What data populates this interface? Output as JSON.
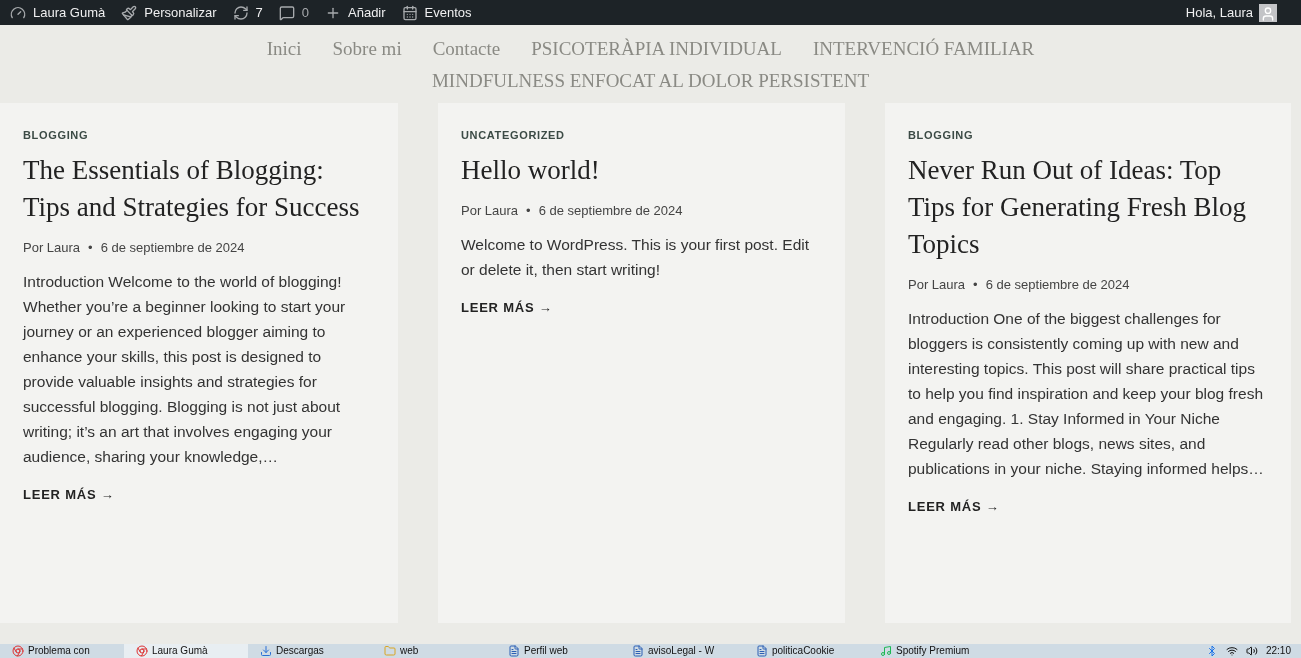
{
  "admin_bar": {
    "items": [
      {
        "kind": "dashboard",
        "label": "Laura Gumà"
      },
      {
        "kind": "customize",
        "label": "Personalizar"
      },
      {
        "kind": "updates",
        "label": "7"
      },
      {
        "kind": "comments",
        "label": "0"
      },
      {
        "kind": "add",
        "label": "Añadir"
      },
      {
        "kind": "events",
        "label": "Eventos"
      }
    ],
    "greeting": "Hola, Laura"
  },
  "nav": {
    "items": [
      "Inici",
      "Sobre mi",
      "Contacte",
      "PSICOTERÀPIA INDIVIDUAL",
      "INTERVENCIÓ FAMILIAR",
      "MINDFULNESS ENFOCAT AL DOLOR PERSISTENT"
    ]
  },
  "posts": [
    {
      "category": "BLOGGING",
      "title": "The Essentials of Blogging: Tips and Strategies for Success",
      "author": "Por Laura",
      "separator": "•",
      "date": "6 de septiembre de 2024",
      "excerpt": "Introduction Welcome to the world of blogging! Whether you’re a beginner looking to start your journey or an experienced blogger aiming to enhance your skills, this post is designed to provide valuable insights and strategies for successful blogging. Blogging is not just about writing; it’s an art that involves engaging your audience, sharing your knowledge,…",
      "more": "LEER MÁS →"
    },
    {
      "category": "UNCATEGORIZED",
      "title": "Hello world!",
      "author": "Por Laura",
      "separator": "•",
      "date": "6 de septiembre de 2024",
      "excerpt": "Welcome to WordPress. This is your first post. Edit or delete it, then start writing!",
      "more": "LEER MÁS →"
    },
    {
      "category": "BLOGGING",
      "title": "Never Run Out of Ideas: Top Tips for Generating Fresh Blog Topics",
      "author": "Por Laura",
      "separator": "•",
      "date": "6 de septiembre de 2024",
      "excerpt": "Introduction One of the biggest challenges for bloggers is consistently coming up with new and interesting topics. This post will share practical tips to help you find inspiration and keep your blog fresh and engaging. 1. Stay Informed in Your Niche Regularly read other blogs, news sites, and publications in your niche. Staying informed helps…",
      "more": "LEER MÁS →"
    }
  ],
  "taskbar": {
    "items": [
      {
        "kind": "browser",
        "label": "Problema con",
        "selected": false
      },
      {
        "kind": "browser",
        "label": "Laura Gumà",
        "selected": true
      },
      {
        "kind": "downloads",
        "label": "Descargas",
        "selected": false
      },
      {
        "kind": "folder",
        "label": "web",
        "selected": false
      },
      {
        "kind": "word",
        "label": "Perfil web",
        "selected": false
      },
      {
        "kind": "word",
        "label": "avisoLegal - W",
        "selected": false
      },
      {
        "kind": "word",
        "label": "politicaCookie",
        "selected": false
      },
      {
        "kind": "spotify",
        "label": "Spotify Premium",
        "selected": false
      }
    ],
    "clock": "22:10"
  }
}
